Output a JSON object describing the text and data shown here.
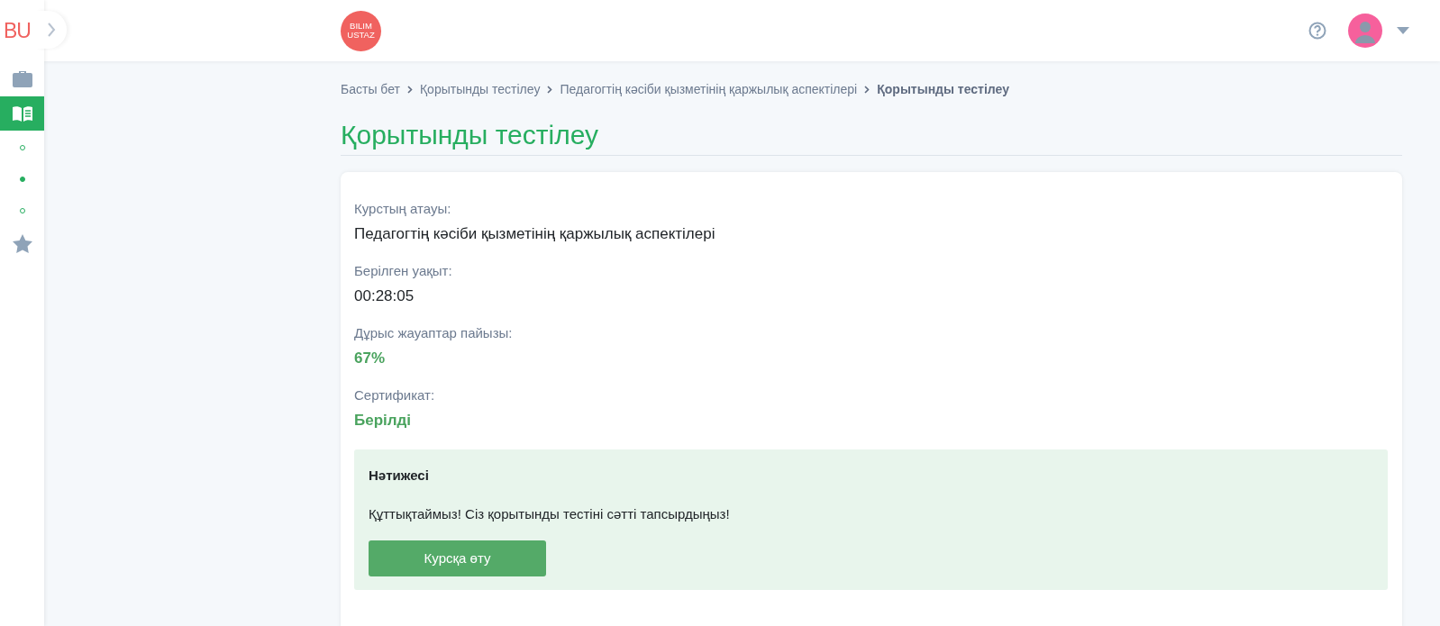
{
  "sidebar": {
    "logo": "BU",
    "items": [
      {
        "kind": "section",
        "selected": false
      },
      {
        "kind": "section",
        "selected": true
      },
      {
        "kind": "subsection",
        "selected": false
      },
      {
        "kind": "subsection",
        "selected": true
      },
      {
        "kind": "subsection",
        "selected": false
      },
      {
        "kind": "section",
        "selected": false
      }
    ]
  },
  "header": {
    "logo_lines": [
      "BILIM",
      "USTAZ"
    ]
  },
  "breadcrumb": [
    {
      "label": "Басты бет",
      "current": false
    },
    {
      "label": "Қорытынды тестілеу",
      "current": false
    },
    {
      "label": "Педагогтің кәсіби қызметінің қаржылық аспектілері",
      "current": false
    },
    {
      "label": "Қорытынды тестілеу",
      "current": true
    }
  ],
  "title": "Қорытынды тестілеу",
  "fields": [
    {
      "label": "Курстың атауы:",
      "value": "Педагогтің кәсіби қызметінің қаржылық аспектілері",
      "highlight": false
    },
    {
      "label": "Берілген уақыт:",
      "value": "00:28:05",
      "highlight": false
    },
    {
      "label": "Дұрыс жауаптар пайызы:",
      "value": "67%",
      "highlight": true
    },
    {
      "label": "Сертификат:",
      "value": "Берілді",
      "highlight": true
    }
  ],
  "result": {
    "title": "Нәтижесі",
    "message": "Құттықтаймыз! Сіз қорытынды тестіні сәтті тапсырдыңыз!",
    "button": "Курсқа өту"
  }
}
